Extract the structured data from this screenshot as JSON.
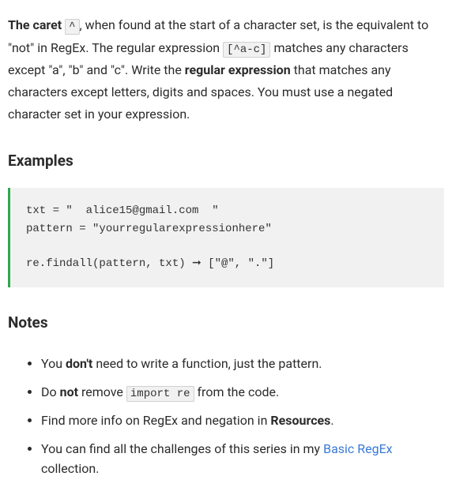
{
  "intro": {
    "strong_lead": "The caret ",
    "code_caret": "^",
    "text_after_caret": ", when found at the start of a character set, is the equivalent to \"not\" in RegEx. The regular expression ",
    "code_class": "[^a-c]",
    "text_after_class": " matches any characters except \"a\", \"b\" and \"c\". Write the ",
    "strong_regex": "regular expression",
    "text_tail": " that matches any characters except letters, digits and spaces. You must use a negated character set in your expression."
  },
  "headings": {
    "examples": "Examples",
    "notes": "Notes"
  },
  "code_example": "txt = \"  alice15@gmail.com  \"\npattern = \"yourregularexpressionhere\"\n\nre.findall(pattern, txt) ➞ [\"@\", \".\"]",
  "notes": [
    {
      "pre": "You ",
      "strong": "don't",
      "mid": " need to write a function, just the pattern.",
      "code": "",
      "post": ""
    },
    {
      "pre": "Do ",
      "strong": "not",
      "mid": " remove ",
      "code": "import re",
      "post": " from the code."
    },
    {
      "pre": "Find more info on RegEx and negation in ",
      "strong": "Resources",
      "mid": ".",
      "code": "",
      "post": ""
    },
    {
      "pre": "You can find all the challenges of this series in my ",
      "link_text": "Basic RegEx",
      "post": " collection."
    }
  ]
}
